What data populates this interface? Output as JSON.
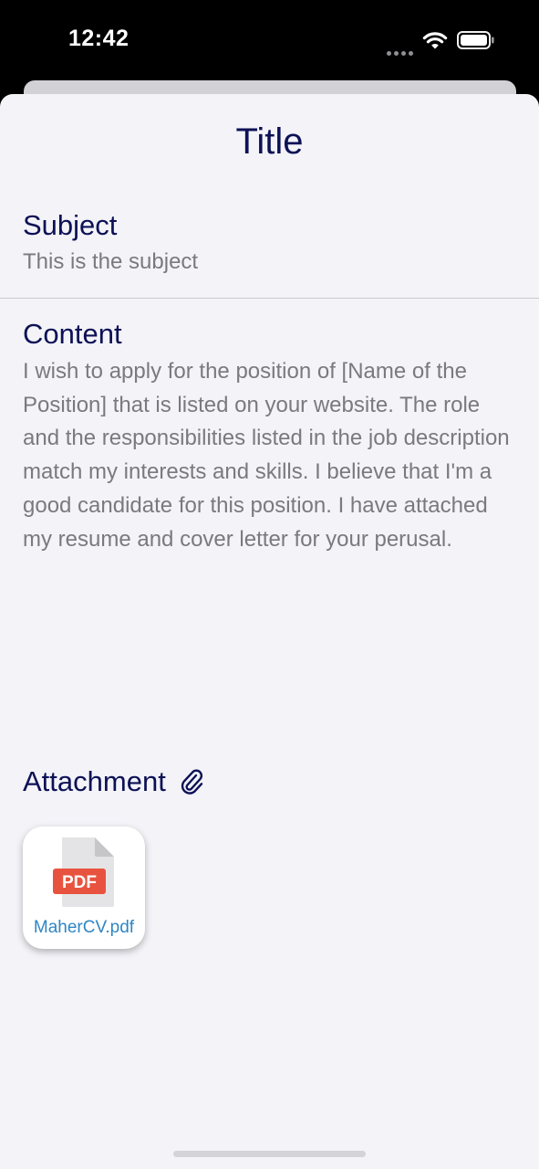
{
  "status_bar": {
    "time": "12:42",
    "icons": [
      "cellular-signal-icon",
      "wifi-icon",
      "battery-icon"
    ]
  },
  "sheet": {
    "title": "Title",
    "subject": {
      "label": "Subject",
      "value": "This is the subject"
    },
    "content": {
      "label": "Content",
      "value": "I wish to apply for the position of [Name of the Position] that is listed on your website. The role and the responsibilities listed in the job description match my interests and skills. I believe that I'm a good candidate for this position. I have attached my resume and cover letter for your perusal."
    },
    "attachment": {
      "label": "Attachment",
      "icon": "paperclip-icon",
      "files": [
        {
          "badge": "PDF",
          "name": "MaherCV.pdf",
          "icon": "pdf-file-icon"
        }
      ]
    }
  },
  "colors": {
    "heading": "#0d1155",
    "body_text": "#7a7a7e",
    "file_name": "#2f86c3",
    "pdf_badge": "#e8533f",
    "sheet_background": "#f3f3f8"
  }
}
